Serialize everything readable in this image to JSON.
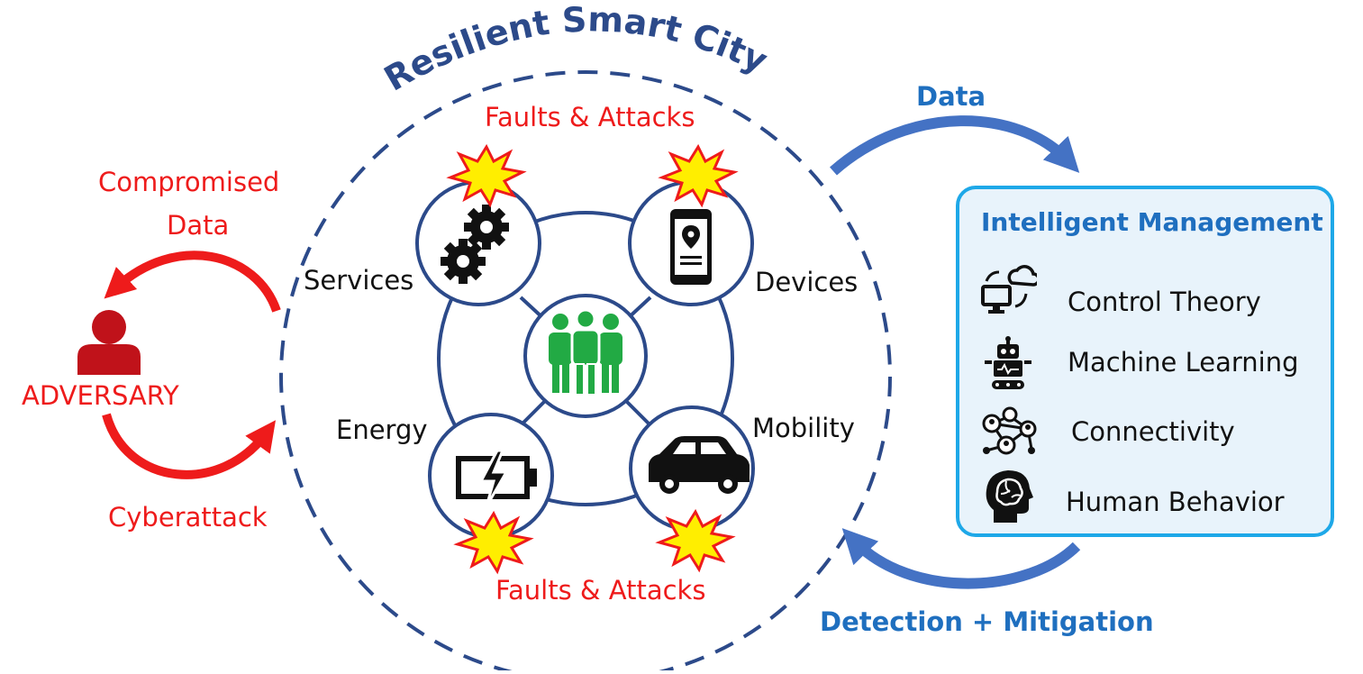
{
  "diagram": {
    "title": "Resilient Smart City",
    "faults_top": "Faults & Attacks",
    "faults_bottom": "Faults & Attacks",
    "nodes": {
      "services": "Services",
      "devices": "Devices",
      "energy": "Energy",
      "mobility": "Mobility"
    },
    "adversary": {
      "label": "ADVERSARY",
      "compromised_line1": "Compromised",
      "compromised_line2": "Data",
      "cyberattack": "Cyberattack"
    },
    "data_label": "Data",
    "detection_label": "Detection + Mitigation",
    "management": {
      "title": "Intelligent Management",
      "items": [
        {
          "label": "Control Theory",
          "icon": "computer-cloud-icon"
        },
        {
          "label": "Machine Learning",
          "icon": "robot-icon"
        },
        {
          "label": "Connectivity",
          "icon": "network-icon"
        },
        {
          "label": "Human Behavior",
          "icon": "brain-head-icon"
        }
      ]
    },
    "colors": {
      "navy": "#2c4a8a",
      "red": "#ee1b1b",
      "blue_arrow": "#4472c4",
      "green_people": "#22aa44",
      "box_border": "#1ea8e8",
      "box_fill": "#e8f3fb",
      "burst_fill": "#ffee00"
    }
  }
}
